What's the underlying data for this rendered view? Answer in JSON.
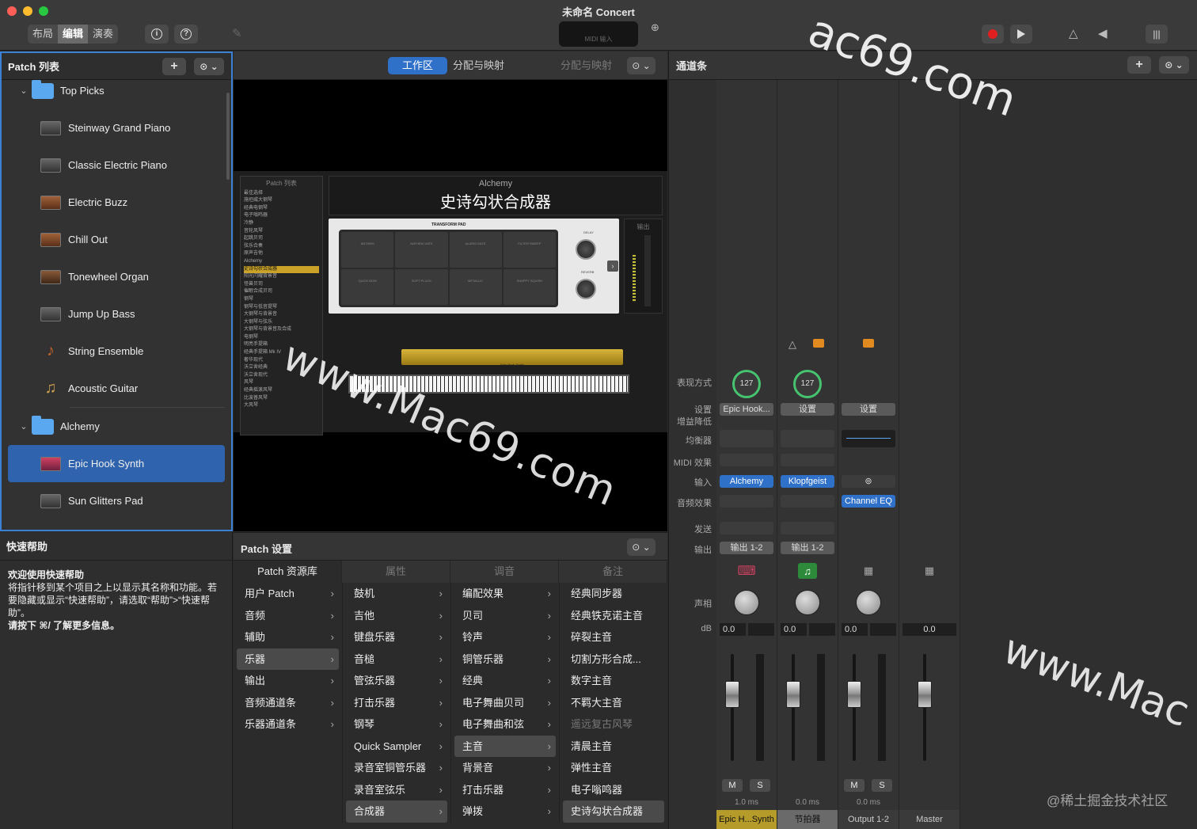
{
  "window": {
    "title": "未命名 Concert"
  },
  "toolbar": {
    "modes": [
      "布局",
      "编辑",
      "演奏"
    ],
    "active_mode": "编辑",
    "lcd_label": "MIDI 输入"
  },
  "patch_list": {
    "title": "Patch 列表",
    "items": [
      {
        "label": "Top Picks",
        "type": "folder"
      },
      {
        "label": "Steinway Grand Piano",
        "type": "patch"
      },
      {
        "label": "Classic Electric Piano",
        "type": "patch"
      },
      {
        "label": "Electric Buzz",
        "type": "patch"
      },
      {
        "label": "Chill Out",
        "type": "patch"
      },
      {
        "label": "Tonewheel Organ",
        "type": "patch"
      },
      {
        "label": "Jump Up Bass",
        "type": "patch"
      },
      {
        "label": "String Ensemble",
        "type": "patch"
      },
      {
        "label": "Acoustic Guitar",
        "type": "patch"
      },
      {
        "label": "Alchemy",
        "type": "folder"
      },
      {
        "label": "Epic Hook Synth",
        "type": "patch",
        "selected": true
      },
      {
        "label": "Sun Glitters Pad",
        "type": "patch"
      }
    ]
  },
  "quick_help": {
    "title": "快速帮助",
    "heading": "欢迎使用快速帮助",
    "body": "将指针移到某个项目之上以显示其名称和功能。若要隐藏或显示“快速帮助”，请选取“帮助”>“快速帮助”。",
    "footer": "请按下 ⌘/ 了解更多信息。"
  },
  "center": {
    "tab_workspace": "工作区",
    "tab_assign": "分配与映射",
    "tab_assign_right": "分配与映射",
    "mini_list_title": "Patch 列表",
    "mini_list_lines": [
      "最佳选择",
      "施坦威大钢琴",
      "经典电钢琴",
      "电子嗡鸣器",
      "冷静",
      "音轮风琴",
      "起跳贝司",
      "弦乐合奏",
      "原声吉他",
      "Alchemy",
      "史诗勾状合成器",
      "阳光闪耀背景音",
      "怪兽贝司",
      "催眠合成贝司",
      "钢琴",
      "钢琴与低音提琴",
      "大钢琴与背景音",
      "大钢琴与弦乐",
      "大钢琴与背景音及合成",
      "电钢琴",
      "明亮手提箱",
      "经典手提箱 Mk IV",
      "奢华现代",
      "沃立舍经典",
      "沃立舍现代",
      "风琴",
      "经典摇滚风琴",
      "比波普风琴",
      "大风琴"
    ],
    "plugin_name": "Alchemy",
    "plugin_title": "史诗勾状合成器",
    "pad_title": "TRANSFORM PAD",
    "pads": [
      "ANTHEM",
      "ANTHEM GATE",
      "ALARM GATE",
      "FILTER SWEEP",
      "QUICK BOW",
      "SOFT PLUCK",
      "METALLIC",
      "SNAPPY SQUISH"
    ],
    "knob1": "DELAY",
    "knob2": "REVERB",
    "out_label": "输出",
    "kb_label": "Epic Hook Synth",
    "watermark": "www.Mac69.com"
  },
  "patch_settings": {
    "title": "Patch 设置",
    "col_library": "Patch 资源库",
    "col_props": "属性",
    "col_tune": "调音",
    "col_notes": "备注",
    "cat1": [
      {
        "label": "用户 Patch"
      },
      {
        "label": "音频"
      },
      {
        "label": "辅助"
      },
      {
        "label": "乐器",
        "selected": true
      },
      {
        "label": "输出"
      },
      {
        "label": "音频通道条"
      },
      {
        "label": "乐器通道条"
      }
    ],
    "cat2": [
      {
        "label": "鼓机"
      },
      {
        "label": "吉他"
      },
      {
        "label": "键盘乐器"
      },
      {
        "label": "音槌"
      },
      {
        "label": "管弦乐器"
      },
      {
        "label": "打击乐器"
      },
      {
        "label": "钢琴"
      },
      {
        "label": "Quick Sampler"
      },
      {
        "label": "录音室铜管乐器"
      },
      {
        "label": "录音室弦乐"
      },
      {
        "label": "合成器",
        "selected": true
      }
    ],
    "cat3": [
      {
        "label": "编配效果"
      },
      {
        "label": "贝司"
      },
      {
        "label": "铃声"
      },
      {
        "label": "铜管乐器"
      },
      {
        "label": "经典"
      },
      {
        "label": "电子舞曲贝司"
      },
      {
        "label": "电子舞曲和弦"
      },
      {
        "label": "主音",
        "selected": true
      },
      {
        "label": "背景音"
      },
      {
        "label": "打击乐器"
      },
      {
        "label": "弹拨"
      }
    ],
    "cat4": [
      {
        "label": "经典同步器"
      },
      {
        "label": "经典铁克诺主音"
      },
      {
        "label": "碎裂主音"
      },
      {
        "label": "切割方形合成..."
      },
      {
        "label": "数字主音"
      },
      {
        "label": "不羁大主音"
      },
      {
        "label": "遥远复古风琴",
        "dim": true
      },
      {
        "label": "清晨主音"
      },
      {
        "label": "弹性主音"
      },
      {
        "label": "电子嗡鸣器"
      },
      {
        "label": "史诗勾状合成器",
        "selected": true
      }
    ]
  },
  "mixer": {
    "title": "通道条",
    "row_labels": [
      "表现方式",
      "设置",
      "增益降低",
      "均衡器",
      "MIDI 效果",
      "输入",
      "音频效果",
      "发送",
      "输出",
      "声相",
      "dB"
    ],
    "strips": [
      {
        "name": "Epic H...Synth",
        "dial": "127",
        "setting": "Epic Hook...",
        "input": "Alchemy",
        "output": "输出 1-2",
        "db": "0.0",
        "latency": "1.0 ms",
        "fader_level": 0.62,
        "name_style": "yel"
      },
      {
        "name": "节拍器",
        "dial": "127",
        "setting": "设置",
        "input": "Klopfgeist",
        "output": "输出 1-2",
        "db": "0.0",
        "latency": "0.0 ms",
        "fader_level": 0.62,
        "name_style": "gry"
      },
      {
        "name": "Output 1-2",
        "setting": "设置",
        "audio_fx": "Channel EQ",
        "db": "0.0",
        "latency": "0.0 ms",
        "fader_level": 0.62,
        "name_style": ""
      },
      {
        "name": "Master",
        "db": "0.0",
        "fader_level": 0.62,
        "name_style": ""
      }
    ],
    "mute": "M",
    "solo": "S"
  },
  "watermarks": {
    "top": "ac69.com",
    "right": "www.Mac",
    "credit": "@稀土掘金技术社区"
  }
}
